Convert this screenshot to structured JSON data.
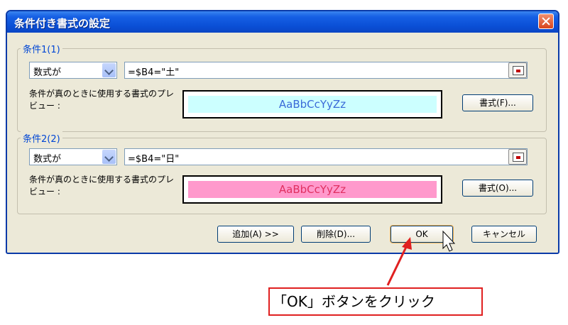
{
  "dialog": {
    "title": "条件付き書式の設定"
  },
  "condition1": {
    "label": "条件1(1)",
    "type_select": "数式が",
    "formula": "=$B4=\"土\"",
    "preview_caption": "条件が真のときに使用する書式のプレビュー :",
    "preview_text": "AaBbCcYyZz",
    "preview_bg": "#ccffff",
    "preview_color": "#3a6ad8",
    "format_button": "書式(F)..."
  },
  "condition2": {
    "label": "条件2(2)",
    "type_select": "数式が",
    "formula": "=$B4=\"日\"",
    "preview_caption": "条件が真のときに使用する書式のプレビュー :",
    "preview_text": "AaBbCcYyZz",
    "preview_bg": "#ff99cc",
    "preview_color": "#e03060",
    "format_button": "書式(O)..."
  },
  "buttons": {
    "add": "追加(A) >>",
    "delete": "削除(D)...",
    "ok": "OK",
    "cancel": "キャンセル"
  },
  "annotation": {
    "text": "「OK」ボタンをクリック",
    "color": "#e02020"
  }
}
